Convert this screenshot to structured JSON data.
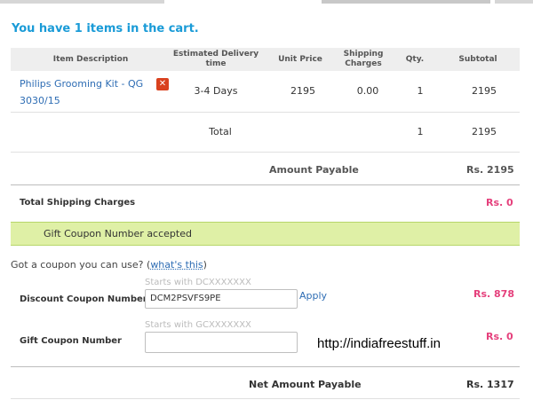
{
  "cart": {
    "summary": "You have 1 items in the cart."
  },
  "table": {
    "headers": {
      "item": "Item Description",
      "delivery": "Estimated Delivery time",
      "unit_price": "Unit Price",
      "shipping": "Shipping Charges",
      "qty": "Qty.",
      "subtotal": "Subtotal"
    },
    "item": {
      "name": "Philips Grooming Kit - QG 3030/15",
      "remove_icon": "close-icon",
      "delivery": "3-4 Days",
      "unit_price": "2195",
      "shipping": "0.00",
      "qty": "1",
      "subtotal": "2195"
    },
    "total": {
      "label": "Total",
      "qty": "1",
      "subtotal": "2195"
    }
  },
  "amount_payable": {
    "label": "Amount Payable",
    "value": "Rs. 2195"
  },
  "shipping": {
    "label": "Total Shipping Charges",
    "value": "Rs. 0"
  },
  "notice": {
    "text": "Gift Coupon Number accepted"
  },
  "coupon": {
    "prompt": "Got a coupon you can use?",
    "prompt_open": "(",
    "link": "what's this",
    "prompt_close": ")",
    "discount": {
      "label": "Discount Coupon Number",
      "hint": "Starts with DCXXXXXXX",
      "value": "DCM2PSVFS9PE",
      "apply": "Apply",
      "amount": "Rs. 878"
    },
    "gift": {
      "label": "Gift Coupon Number",
      "hint": "Starts with GCXXXXXXX",
      "value": "",
      "amount": "Rs. 0"
    }
  },
  "net": {
    "label": "Net Amount Payable",
    "value": "Rs. 1317"
  },
  "watermark": "http://indiafreestuff.in",
  "colors": {
    "heading": "#1a9bd7",
    "link": "#2e6db4",
    "accent_pink": "#e5407c",
    "success_bg": "#dff0a6",
    "remove": "#d9411e"
  }
}
